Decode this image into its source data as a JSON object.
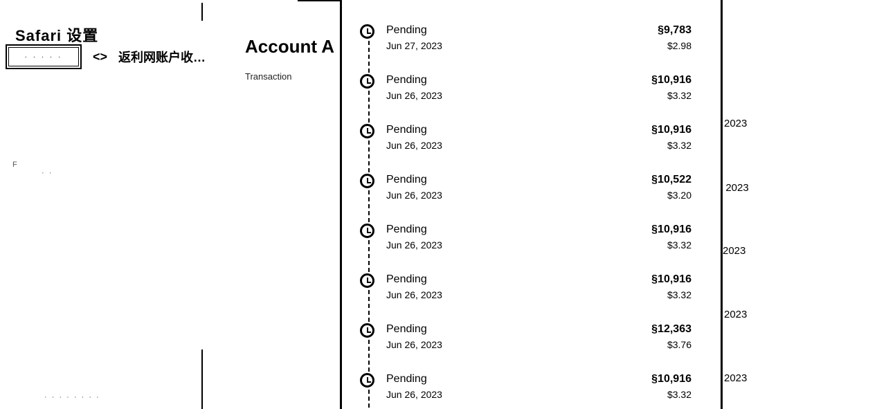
{
  "left_panel": {
    "top_label": "Safari 设置",
    "back_box_label": "· · · · ·",
    "back_arrow": "<>",
    "back_text": "返利网账户收…",
    "faded_items": [
      "F",
      "· ·",
      "· · · · · · · ·"
    ]
  },
  "account": {
    "title": "Account A",
    "subtitle": "Transaction"
  },
  "right_dates": [
    "2023",
    ", 2023",
    "2023",
    "2023",
    "2023"
  ],
  "transactions": [
    {
      "status": "Pending",
      "date": "Jun 27, 2023",
      "amount": "§9,783",
      "fee": "$2.98"
    },
    {
      "status": "Pending",
      "date": "Jun 26, 2023",
      "amount": "§10,916",
      "fee": "$3.32"
    },
    {
      "status": "Pending",
      "date": "Jun 26, 2023",
      "amount": "§10,916",
      "fee": "$3.32"
    },
    {
      "status": "Pending",
      "date": "Jun 26, 2023",
      "amount": "§10,522",
      "fee": "$3.20"
    },
    {
      "status": "Pending",
      "date": "Jun 26, 2023",
      "amount": "§10,916",
      "fee": "$3.32"
    },
    {
      "status": "Pending",
      "date": "Jun 26, 2023",
      "amount": "§10,916",
      "fee": "$3.32"
    },
    {
      "status": "Pending",
      "date": "Jun 26, 2023",
      "amount": "§12,363",
      "fee": "$3.76"
    },
    {
      "status": "Pending",
      "date": "Jun 26, 2023",
      "amount": "§10,916",
      "fee": "$3.32"
    }
  ]
}
